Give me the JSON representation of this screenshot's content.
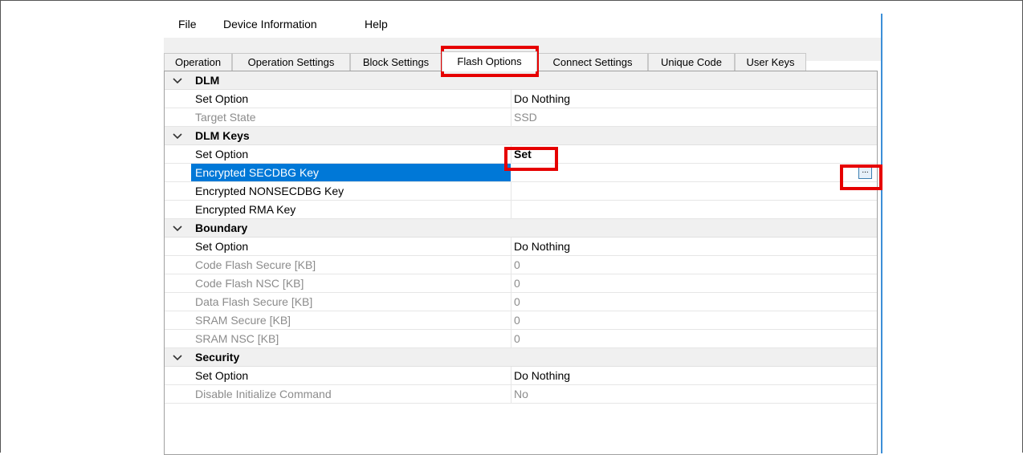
{
  "menu": [
    "File",
    "Device Information",
    "Help"
  ],
  "tabs": [
    {
      "label": "Operation"
    },
    {
      "label": "Operation Settings"
    },
    {
      "label": "Block Settings"
    },
    {
      "label": "Flash Options",
      "active": true
    },
    {
      "label": "Connect Settings"
    },
    {
      "label": "Unique Code"
    },
    {
      "label": "User Keys"
    }
  ],
  "grid": {
    "categories": [
      {
        "name": "DLM",
        "rows": [
          {
            "label": "Set Option",
            "value": "Do Nothing"
          },
          {
            "label": "Target State",
            "value": "SSD",
            "disabled": true
          }
        ]
      },
      {
        "name": "DLM Keys",
        "rows": [
          {
            "label": "Set Option",
            "value": "Set",
            "bold": true
          },
          {
            "label": "Encrypted SECDBG Key",
            "value": "",
            "selected": true,
            "ellipsis_button": "..."
          },
          {
            "label": "Encrypted NONSECDBG Key",
            "value": ""
          },
          {
            "label": "Encrypted RMA Key",
            "value": ""
          }
        ]
      },
      {
        "name": "Boundary",
        "rows": [
          {
            "label": "Set Option",
            "value": "Do Nothing"
          },
          {
            "label": "Code Flash Secure [KB]",
            "value": "0",
            "disabled": true
          },
          {
            "label": "Code Flash NSC [KB]",
            "value": "0",
            "disabled": true
          },
          {
            "label": "Data Flash Secure [KB]",
            "value": "0",
            "disabled": true
          },
          {
            "label": "SRAM Secure [KB]",
            "value": "0",
            "disabled": true
          },
          {
            "label": "SRAM NSC [KB]",
            "value": "0",
            "disabled": true
          }
        ]
      },
      {
        "name": "Security",
        "rows": [
          {
            "label": "Set Option",
            "value": "Do Nothing"
          },
          {
            "label": "Disable Initialize Command",
            "value": "No",
            "disabled": true
          }
        ]
      }
    ]
  },
  "colors": {
    "highlight_box": "#e60000",
    "selection": "#0078d7",
    "category_bg": "#f0f0f0",
    "disabled_text": "#8c8c8c"
  }
}
